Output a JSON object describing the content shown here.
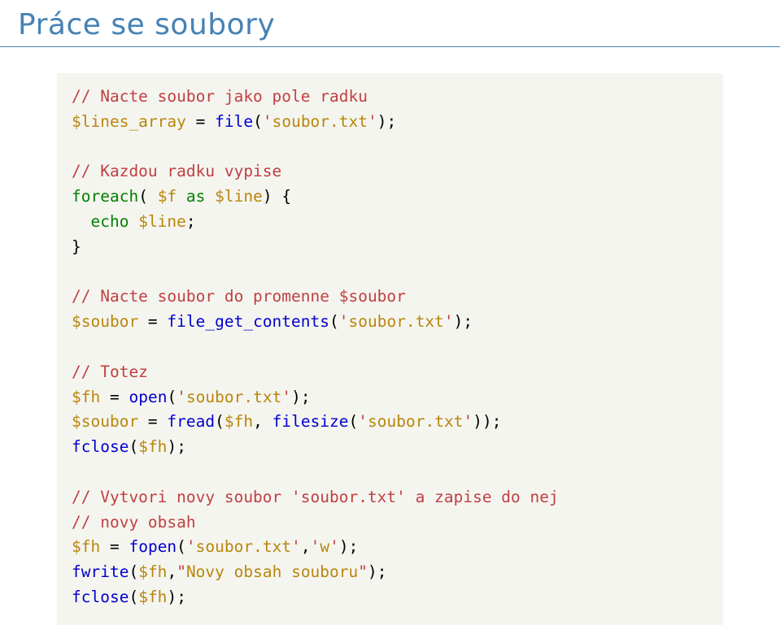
{
  "title": "Práce se soubory",
  "code": {
    "c1": "// Nacte soubor jako pole radku",
    "v_lines": "$lines_array",
    "fn_file": "file",
    "s_soubor": "soubor.txt",
    "c2": "// Kazdou radku vypise",
    "kw_foreach": "foreach",
    "v_f": "$f",
    "kw_as": "as",
    "v_line": "$line",
    "kw_echo": "echo",
    "c3": "// Nacte soubor do promenne $soubor",
    "v_soubor": "$soubor",
    "fn_fgc": "file_get_contents",
    "c4": "// Totez",
    "v_fh": "$fh",
    "fn_open": "open",
    "fn_fread": "fread",
    "fn_filesize": "filesize",
    "fn_fclose": "fclose",
    "c5": "// Vytvori novy soubor 'soubor.txt' a zapise do nej",
    "c6": "// novy obsah",
    "fn_fopen": "fopen",
    "s_w": "w",
    "fn_fwrite": "fwrite",
    "s_novy": "Novy obsah souboru",
    "eq": " = ",
    "sc": ";",
    "op": "(",
    "cp": ")",
    "ob": " {",
    "cb": "}",
    "cm": ",",
    "sp": " ",
    "sq": "'",
    "dq": "\"",
    "ind": "  "
  }
}
